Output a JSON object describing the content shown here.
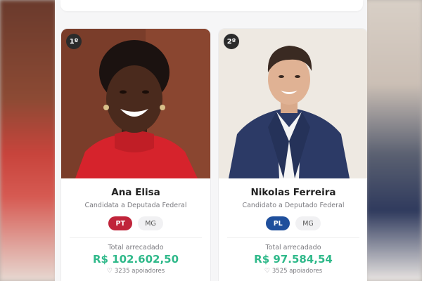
{
  "candidates": [
    {
      "rank": "1º",
      "name": "Ana Elisa",
      "role": "Candidata a Deputada Federal",
      "party": "PT",
      "party_color": "#c0243a",
      "state": "MG",
      "total_label": "Total arrecadado",
      "amount": "R$ 102.602,50",
      "supporters": "3235 apoiadores",
      "heart_icon": "heart-outline-icon"
    },
    {
      "rank": "2º",
      "name": "Nikolas Ferreira",
      "role": "Candidato a Deputado Federal",
      "party": "PL",
      "party_color": "#1f4f9c",
      "state": "MG",
      "total_label": "Total arrecadado",
      "amount": "R$ 97.584,54",
      "supporters": "3525 apoiadores",
      "heart_icon": "heart-outline-icon"
    }
  ],
  "colors": {
    "amount_green": "#2fb98a",
    "rank_badge": "#2b2b2b"
  }
}
